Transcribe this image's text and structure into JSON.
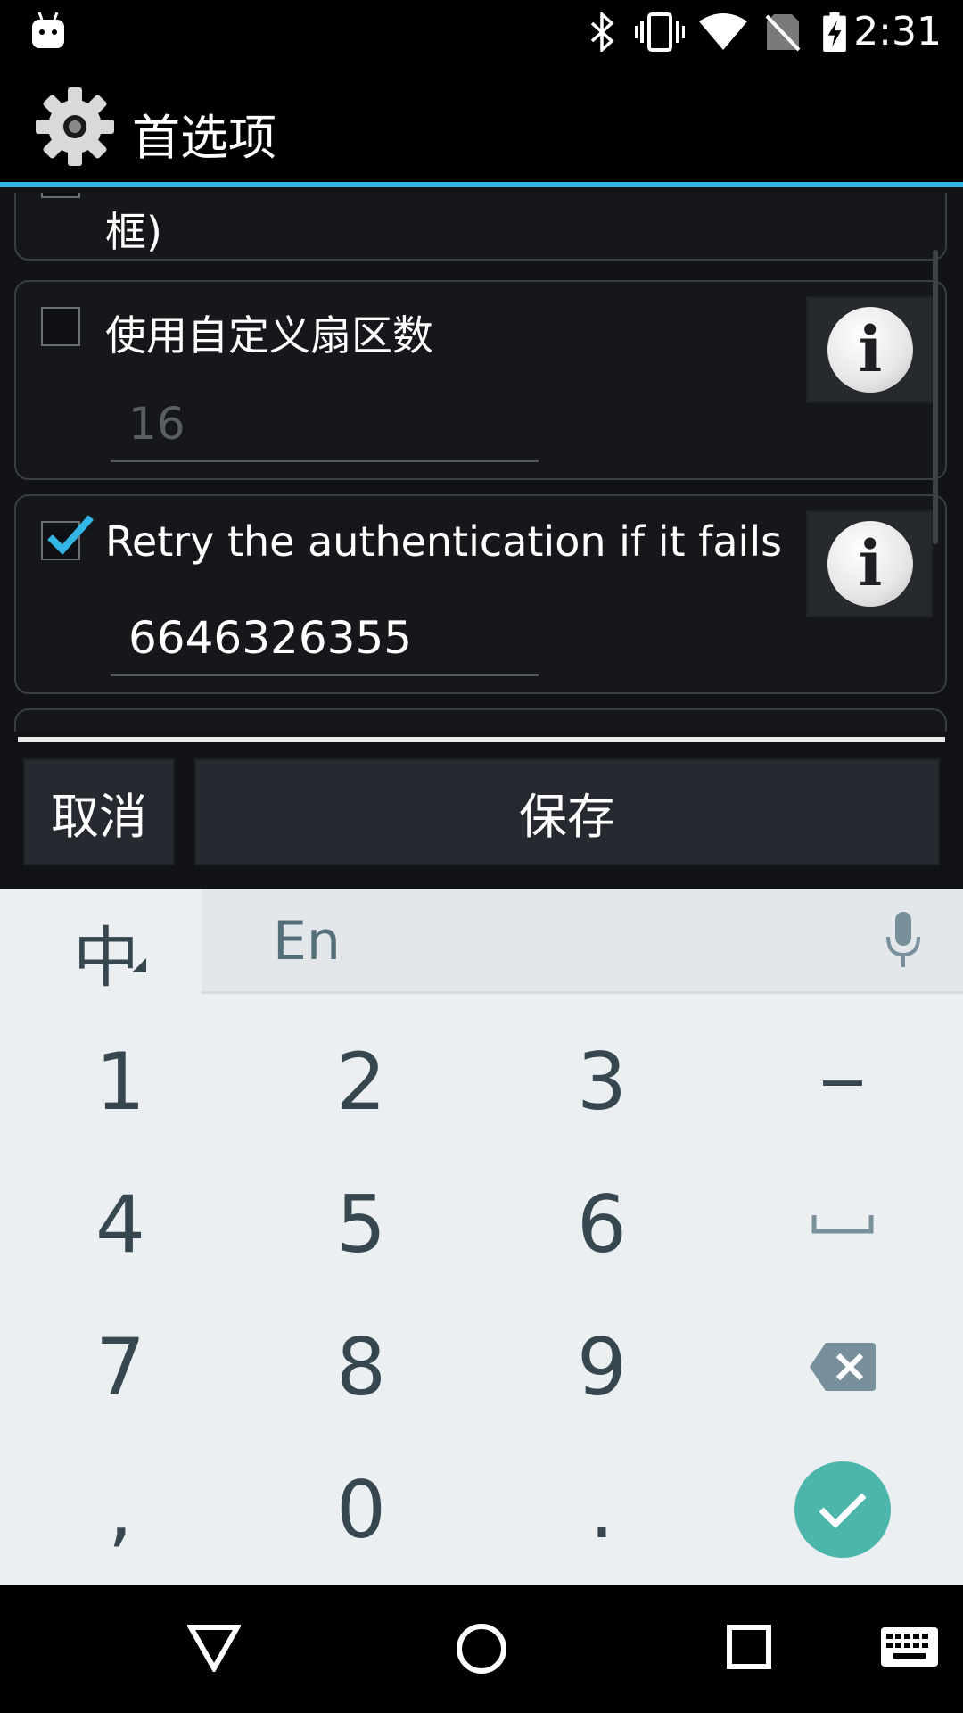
{
  "status_bar": {
    "time": "2:31"
  },
  "app_bar": {
    "title": "首选项"
  },
  "list": {
    "partial_item_label": "框)",
    "items": [
      {
        "label": "使用自定义扇区数",
        "value": "16",
        "checked": false,
        "enabled": false
      },
      {
        "label": "Retry the authentication if it fails",
        "value": "6646326355",
        "checked": true,
        "enabled": true
      }
    ]
  },
  "actions": {
    "cancel": "取消",
    "save": "保存"
  },
  "keyboard": {
    "lang_label": "中",
    "candidate_text": "En",
    "rows": [
      [
        "1",
        "2",
        "3",
        "−"
      ],
      [
        "4",
        "5",
        "6",
        "space"
      ],
      [
        "7",
        "8",
        "9",
        "backspace"
      ],
      [
        ",",
        "0",
        ".",
        "enter"
      ]
    ]
  },
  "colors": {
    "accent": "#33b5e5",
    "enter_key": "#4db6ac"
  }
}
